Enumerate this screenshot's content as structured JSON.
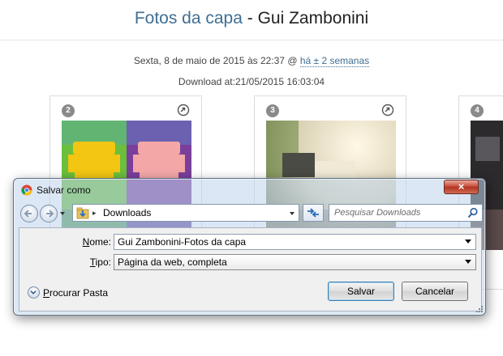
{
  "page": {
    "album_title": "Fotos da capa",
    "separator": " - ",
    "user_name": "Gui Zambonini",
    "date_text": "Sexta, 8 de maio de 2015 às 22:37 @",
    "ago_text": "há ± 2 semanas",
    "download_text": "Download at:21/05/2015 16:03:04",
    "cards": [
      {
        "number": "2"
      },
      {
        "number": "3"
      },
      {
        "number": "4"
      }
    ]
  },
  "dialog": {
    "title": "Salvar como",
    "close_label": "×",
    "address": {
      "current_folder": "Downloads",
      "separator": "▸"
    },
    "search": {
      "placeholder": "Pesquisar Downloads"
    },
    "name_label_key": "N",
    "name_label_rest": "ome:",
    "name_value": "Gui Zambonini-Fotos da capa",
    "type_label_key": "T",
    "type_label_rest": "ipo:",
    "type_value": "Página da web, completa",
    "browse_key": "P",
    "browse_rest": "rocurar Pasta",
    "save_label": "Salvar",
    "cancel_label": "Cancelar"
  },
  "colors": {
    "accent_link": "#3f6e93",
    "close_button": "#c9503d",
    "dialog_glass": "#bed4eb"
  },
  "icons": [
    "chrome-icon",
    "back-arrow-icon",
    "forward-arrow-icon",
    "folder-icon",
    "refresh-icon",
    "search-icon",
    "share-icon",
    "chevron-down-icon",
    "resize-grip-icon"
  ]
}
